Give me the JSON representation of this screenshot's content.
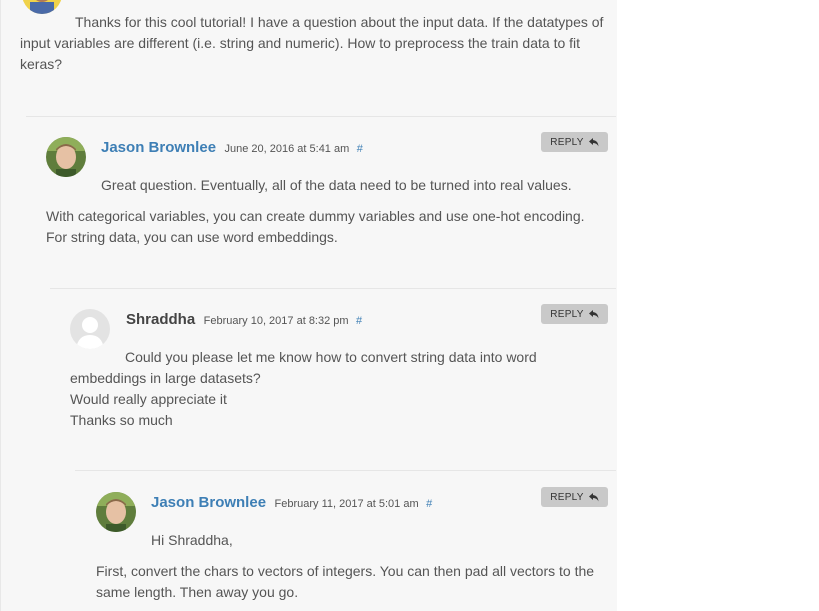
{
  "first_comment": {
    "text": "Thanks for this cool tutorial! I have a question about the input data. If the datatypes of input variables are different (i.e. string and numeric). How to preprocess the train data to fit keras?"
  },
  "reply_1": {
    "author": "Jason Brownlee",
    "date": "June 20, 2016 at 5:41 am",
    "permalink": "#",
    "reply_label": "REPLY",
    "paragraph_1": "Great question. Eventually, all of the data need to be turned into real values.",
    "paragraph_2_line_1": "With categorical variables, you can create dummy variables and use one-hot encoding.",
    "paragraph_2_line_2": "For string data, you can use word embeddings."
  },
  "reply_2": {
    "author": "Shraddha",
    "date": "February 10, 2017 at 8:32 pm",
    "permalink": "#",
    "reply_label": "REPLY",
    "line_1": "Could you please let me know how to convert string data into word",
    "line_2": "embeddings in large datasets?",
    "line_3": "Would really appreciate it",
    "line_4": "Thanks so much"
  },
  "reply_3": {
    "author": "Jason Brownlee",
    "date": "February 11, 2017 at 5:01 am",
    "permalink": "#",
    "reply_label": "REPLY",
    "greeting": "Hi Shraddha,",
    "line_1": "First, convert the chars to vectors of integers. You can then pad all vectors to the",
    "line_2": "same length. Then away you go."
  },
  "colors": {
    "author_link": "#3e7fb5",
    "panel_bg": "#f7f7f7",
    "reply_button_bg": "#c9c9c9"
  }
}
